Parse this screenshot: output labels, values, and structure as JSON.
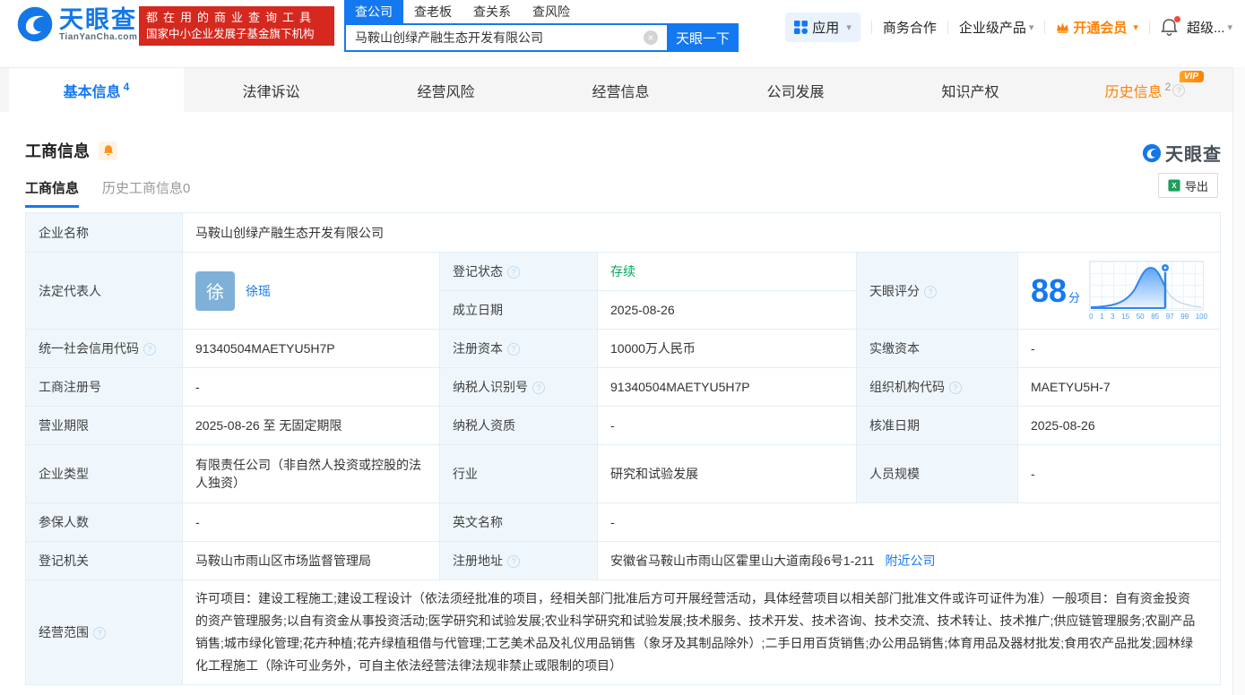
{
  "colors": {
    "accent_blue": "#1478f0",
    "vip_orange": "#ff8000",
    "status_green": "#00a65e",
    "badge_red": "#d5291f"
  },
  "icons": {
    "help": "?",
    "caret": "▾",
    "clear": "×"
  },
  "header": {
    "logo": {
      "cn": "天眼查",
      "en": "TianYanCha.com"
    },
    "slogan": {
      "line1": "都在用的商业查询工具",
      "line2": "国家中小企业发展子基金旗下机构"
    },
    "search": {
      "tabs": [
        {
          "label": "查公司"
        },
        {
          "label": "查老板"
        },
        {
          "label": "查关系"
        },
        {
          "label": "查风险"
        }
      ],
      "value": "马鞍山创绿产融生态开发有限公司",
      "button": "天眼一下"
    },
    "nav": {
      "apps_label": "应用",
      "biz_label": "商务合作",
      "enterprise_label": "企业级产品",
      "vip_label": "开通会员",
      "super_label": "超级..."
    }
  },
  "tabs": [
    {
      "label": "基本信息",
      "count": "4"
    },
    {
      "label": "法律诉讼"
    },
    {
      "label": "经营风险"
    },
    {
      "label": "经营信息"
    },
    {
      "label": "公司发展"
    },
    {
      "label": "知识产权"
    },
    {
      "label": "历史信息",
      "count": "2",
      "vip_badge": "VIP"
    }
  ],
  "section": {
    "title": "工商信息",
    "watermark": "天眼查",
    "subtabs": [
      {
        "label": "工商信息"
      },
      {
        "label": "历史工商信息0"
      }
    ],
    "export": "导出"
  },
  "table": {
    "company_name_label": "企业名称",
    "company_name": "马鞍山创绿产融生态开发有限公司",
    "legal_rep_label": "法定代表人",
    "legal_rep_avatar": "徐",
    "legal_rep_name": "徐瑶",
    "reg_status_label": "登记状态",
    "reg_status": "存续",
    "est_date_label": "成立日期",
    "est_date": "2025-08-26",
    "score_label": "天眼评分",
    "score": "88",
    "score_unit": "分",
    "score_axis": [
      "0",
      "1",
      "3",
      "15",
      "50",
      "85",
      "97",
      "99",
      "100"
    ],
    "credit_code_label": "统一社会信用代码",
    "credit_code": "91340504MAETYU5H7P",
    "reg_capital_label": "注册资本",
    "reg_capital": "10000万人民币",
    "paid_capital_label": "实缴资本",
    "paid_capital": "-",
    "reg_number_label": "工商注册号",
    "reg_number": "-",
    "taxpayer_id_label": "纳税人识别号",
    "taxpayer_id": "91340504MAETYU5H7P",
    "org_code_label": "组织机构代码",
    "org_code": "MAETYU5H-7",
    "business_term_label": "营业期限",
    "business_term": "2025-08-26 至 无固定期限",
    "taxpayer_qual_label": "纳税人资质",
    "taxpayer_qual": "-",
    "approval_date_label": "核准日期",
    "approval_date": "2025-08-26",
    "company_type_label": "企业类型",
    "company_type": "有限责任公司（非自然人投资或控股的法人独资）",
    "industry_label": "行业",
    "industry": "研究和试验发展",
    "staff_size_label": "人员规模",
    "staff_size": "-",
    "insured_label": "参保人数",
    "insured": "-",
    "english_name_label": "英文名称",
    "english_name": "-",
    "reg_authority_label": "登记机关",
    "reg_authority": "马鞍山市雨山区市场监督管理局",
    "reg_address_label": "注册地址",
    "reg_address": "安徽省马鞍山市雨山区霍里山大道南段6号1-211",
    "nearby_link": "附近公司",
    "business_scope_label": "经营范围",
    "business_scope": "许可项目：建设工程施工;建设工程设计（依法须经批准的项目，经相关部门批准后方可开展经营活动，具体经营项目以相关部门批准文件或许可证件为准）一般项目：自有资金投资的资产管理服务;以自有资金从事投资活动;医学研究和试验发展;农业科学研究和试验发展;技术服务、技术开发、技术咨询、技术交流、技术转让、技术推广;供应链管理服务;农副产品销售;城市绿化管理;花卉种植;花卉绿植租借与代管理;工艺美术品及礼仪用品销售（象牙及其制品除外）;二手日用百货销售;办公用品销售;体育用品及器材批发;食用农产品批发;园林绿化工程施工（除许可业务外，可自主依法经营法律法规非禁止或限制的项目）"
  }
}
